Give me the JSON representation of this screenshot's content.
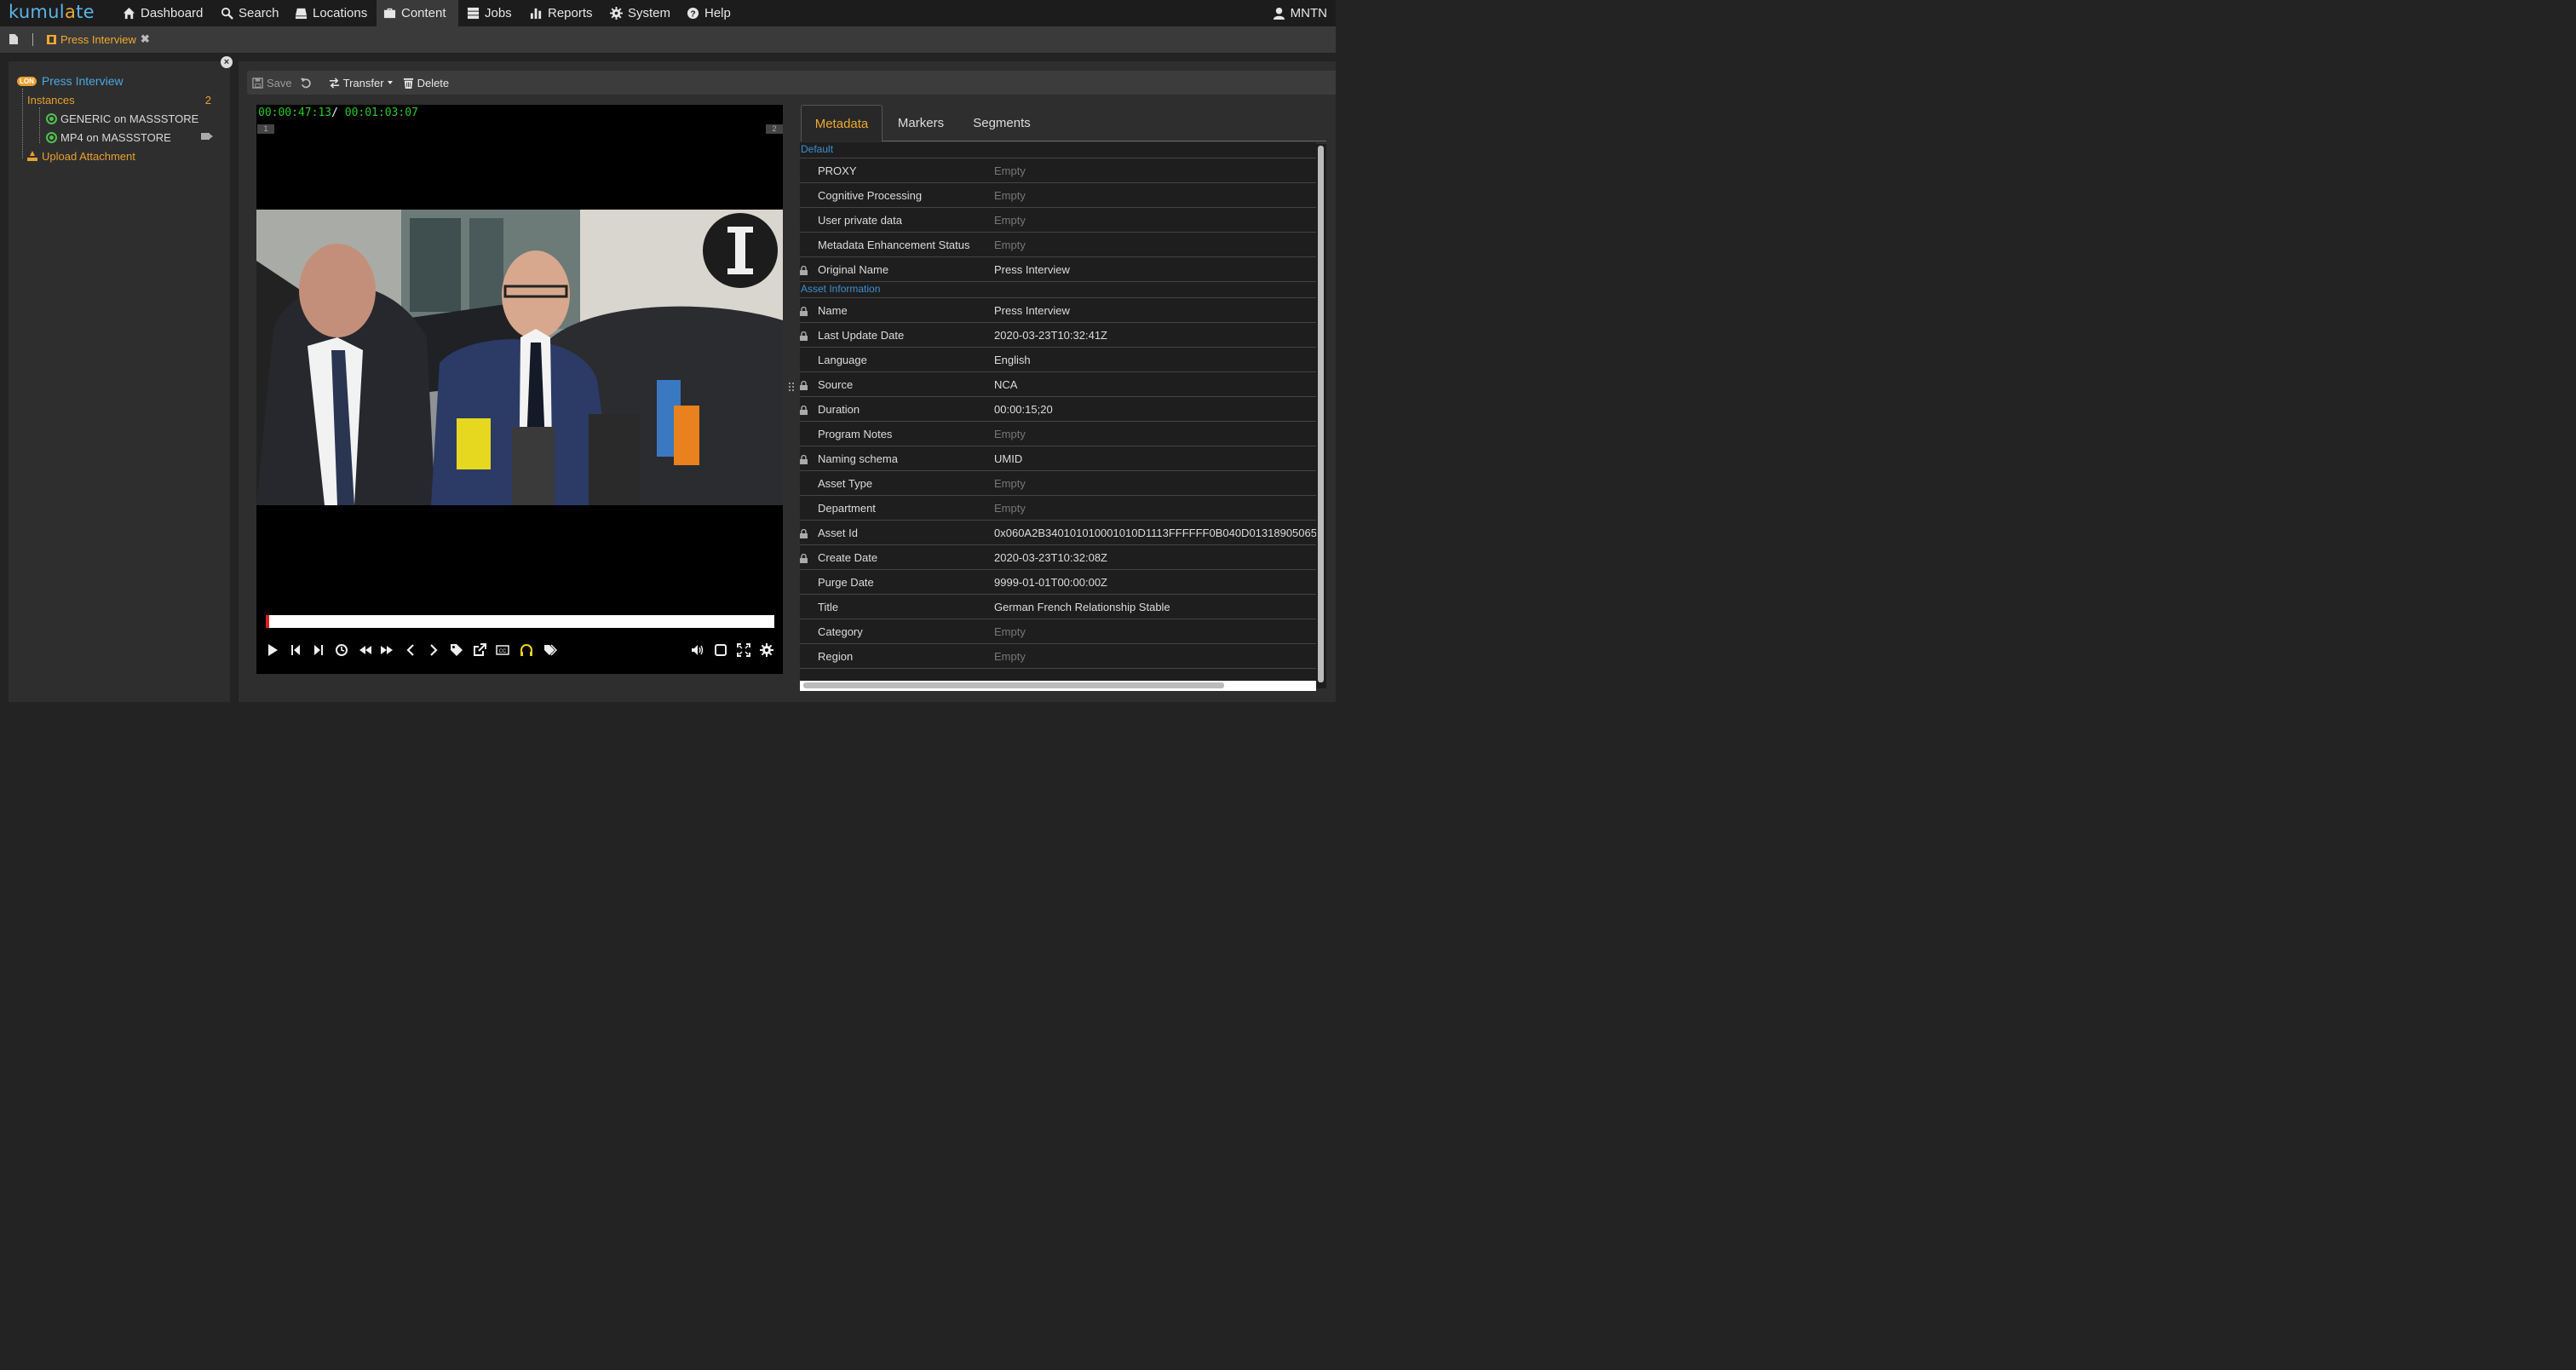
{
  "app": {
    "logo_left": "kumul",
    "logo_mid": "a",
    "logo_right": "te"
  },
  "nav": {
    "items": [
      {
        "label": "Dashboard",
        "icon": "home-icon"
      },
      {
        "label": "Search",
        "icon": "search-icon"
      },
      {
        "label": "Locations",
        "icon": "storage-icon"
      },
      {
        "label": "Content",
        "icon": "briefcase-icon",
        "active": true
      },
      {
        "label": "Jobs",
        "icon": "tasks-icon"
      },
      {
        "label": "Reports",
        "icon": "chart-icon"
      },
      {
        "label": "System",
        "icon": "gear-icon"
      },
      {
        "label": "Help",
        "icon": "help-icon"
      }
    ],
    "user": "MNTN"
  },
  "tabbar": {
    "asset_tab": "Press Interview",
    "close": "✖"
  },
  "tree": {
    "badge": "LON",
    "root": "Press Interview",
    "instances_label": "Instances",
    "instances_count": "2",
    "instances": [
      "GENERIC on MASSSTORE",
      "MP4 on MASSSTORE"
    ],
    "upload": "Upload Attachment"
  },
  "toolbar": {
    "save": "Save",
    "transfer": "Transfer",
    "delete": "Delete"
  },
  "player": {
    "current": "00:00:47:13",
    "slash": "/",
    "duration": "00:01:03:07",
    "marker_in": "1",
    "marker_out": "2",
    "progress": 0.006
  },
  "tabs": [
    "Metadata",
    "Markers",
    "Segments"
  ],
  "metadata": {
    "sections": [
      {
        "title": "Default",
        "rows": [
          {
            "label": "PROXY",
            "value": "Empty",
            "locked": false,
            "empty": true
          },
          {
            "label": "Cognitive Processing",
            "value": "Empty",
            "locked": false,
            "empty": true
          },
          {
            "label": "User private data",
            "value": "Empty",
            "locked": false,
            "empty": true
          },
          {
            "label": "Metadata Enhancement Status",
            "value": "Empty",
            "locked": false,
            "empty": true
          },
          {
            "label": "Original Name",
            "value": "Press Interview",
            "locked": true,
            "empty": false
          }
        ]
      },
      {
        "title": "Asset Information",
        "rows": [
          {
            "label": "Name",
            "value": "Press Interview",
            "locked": true,
            "empty": false
          },
          {
            "label": "Last Update Date",
            "value": "2020-03-23T10:32:41Z",
            "locked": true,
            "empty": false
          },
          {
            "label": "Language",
            "value": "English",
            "locked": false,
            "empty": false
          },
          {
            "label": "Source",
            "value": "NCA",
            "locked": true,
            "empty": false
          },
          {
            "label": "Duration",
            "value": "00:00:15;20",
            "locked": true,
            "empty": false
          },
          {
            "label": "Program Notes",
            "value": "Empty",
            "locked": false,
            "empty": true
          },
          {
            "label": "Naming schema",
            "value": "UMID",
            "locked": true,
            "empty": false
          },
          {
            "label": "Asset Type",
            "value": "Empty",
            "locked": false,
            "empty": true
          },
          {
            "label": "Department",
            "value": "Empty",
            "locked": false,
            "empty": true
          },
          {
            "label": "Asset Id",
            "value": "0x060A2B340101010001010D1113FFFFFF0B040D01318905065",
            "locked": true,
            "empty": false
          },
          {
            "label": "Create Date",
            "value": "2020-03-23T10:32:08Z",
            "locked": true,
            "empty": false
          },
          {
            "label": "Purge Date",
            "value": "9999-01-01T00:00:00Z",
            "locked": false,
            "empty": false
          },
          {
            "label": "Title",
            "value": "German French Relationship Stable",
            "locked": false,
            "empty": false
          },
          {
            "label": "Category",
            "value": "Empty",
            "locked": false,
            "empty": true
          },
          {
            "label": "Region",
            "value": "Empty",
            "locked": false,
            "empty": true
          }
        ]
      }
    ]
  },
  "colors": {
    "accent": "#f0a830",
    "link": "#4aa8e0",
    "timecode": "#28c828",
    "progress": "#d42020"
  }
}
